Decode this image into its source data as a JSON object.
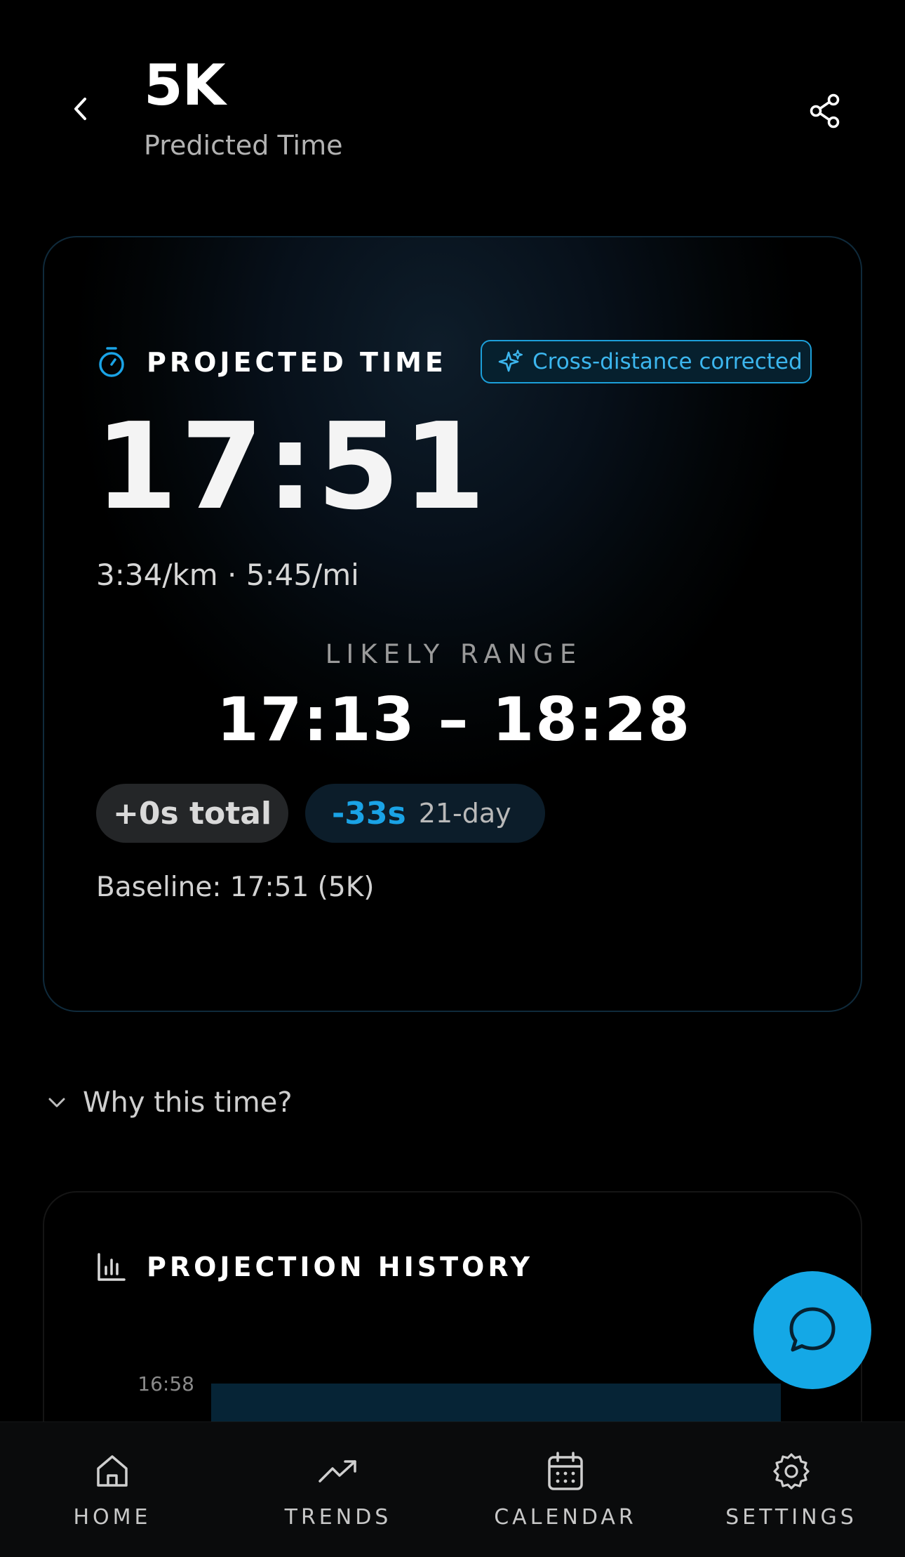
{
  "header": {
    "title": "5K",
    "subtitle": "Predicted Time",
    "back_icon": "chevron-left-icon",
    "share_icon": "share-icon"
  },
  "projection": {
    "label": "PROJECTED TIME",
    "badge": "Cross-distance corrected",
    "time": "17:51",
    "pace": "3:34/km · 5:45/mi",
    "range_label": "LIKELY RANGE",
    "range": "17:13 – 18:28",
    "total_change": "+0s total",
    "delta_value": "-33s",
    "delta_label": "21-day",
    "baseline": "Baseline: 17:51 (5K)"
  },
  "why": {
    "label": "Why this time?"
  },
  "history": {
    "label": "PROJECTION HISTORY"
  },
  "chart_data": {
    "type": "bar",
    "title": "PROJECTION HISTORY",
    "y_tick_labels": [
      "16:58"
    ],
    "visible_bar": {
      "top": "16:58"
    }
  },
  "nav": {
    "items": [
      {
        "label": "HOME",
        "icon": "home-icon"
      },
      {
        "label": "TRENDS",
        "icon": "trending-up-icon"
      },
      {
        "label": "CALENDAR",
        "icon": "calendar-icon"
      },
      {
        "label": "SETTINGS",
        "icon": "gear-icon"
      }
    ]
  },
  "colors": {
    "accent": "#14a8e6",
    "badge_text": "#3cb6ee",
    "card_border": "#0f2a3b",
    "background": "#000000"
  }
}
